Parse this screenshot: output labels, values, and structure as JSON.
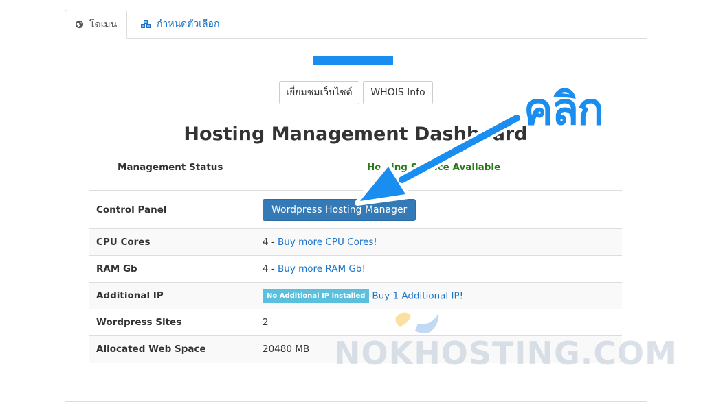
{
  "tabs": [
    {
      "label": "โดเมน",
      "icon": "globe-icon",
      "active": true
    },
    {
      "label": "กำหนดตัวเลือก",
      "icon": "cubes-icon",
      "active": false
    }
  ],
  "actions": {
    "visit_site": "เยี่ยมชมเว็บไซต์",
    "whois": "WHOIS Info"
  },
  "dashboard": {
    "title": "Hosting Management Dashboard",
    "status_label": "Management Status",
    "status_value": "Hosting Service Available"
  },
  "rows": {
    "control_panel": {
      "label": "Control Panel",
      "button": "Wordpress Hosting Manager"
    },
    "cpu": {
      "label": "CPU Cores",
      "value": "4 - ",
      "link": "Buy more CPU Cores!"
    },
    "ram": {
      "label": "RAM Gb",
      "value": "4 - ",
      "link": "Buy more RAM Gb!"
    },
    "ip": {
      "label": "Additional IP",
      "badge": "No Additional IP installed",
      "link": "Buy 1 Additional IP!"
    },
    "wp_sites": {
      "label": "Wordpress Sites",
      "value": "2"
    },
    "web_space": {
      "label": "Allocated Web Space",
      "value": "20480 MB"
    }
  },
  "annotation": {
    "label": "คลิก",
    "color": "#1a8ef0"
  },
  "watermark": {
    "text": "NOKHOSTING.COM"
  },
  "colors": {
    "link": "#1a73c8",
    "primary_button": "#337ab7",
    "badge": "#5bc0de",
    "status_ok": "#2a7a1a"
  }
}
